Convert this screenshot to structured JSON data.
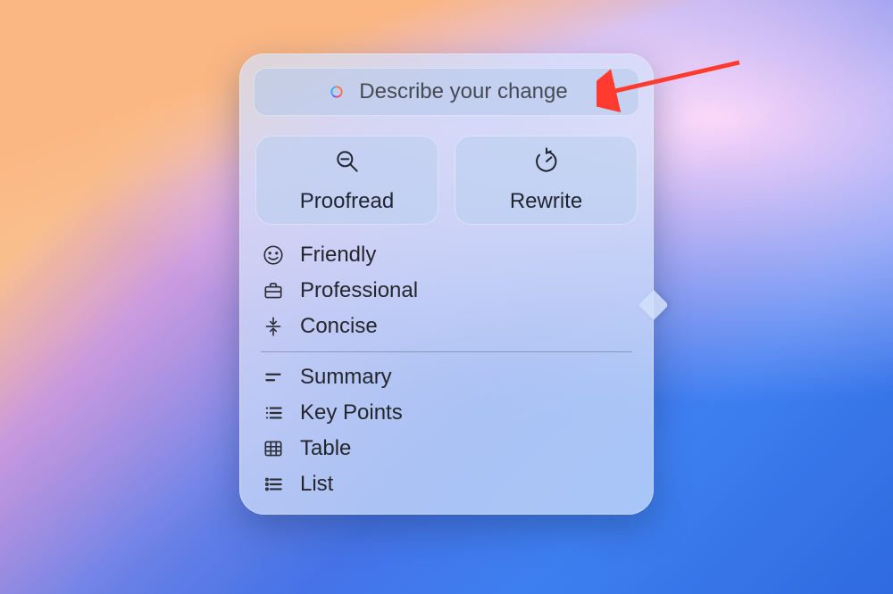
{
  "prompt": {
    "placeholder": "Describe your change",
    "icon": "apple-intelligence-logo"
  },
  "actions": [
    {
      "id": "proofread",
      "label": "Proofread",
      "icon": "search-check-icon"
    },
    {
      "id": "rewrite",
      "label": "Rewrite",
      "icon": "refresh-arrow-icon"
    }
  ],
  "tone_options": [
    {
      "id": "friendly",
      "label": "Friendly",
      "icon": "smile-icon"
    },
    {
      "id": "professional",
      "label": "Professional",
      "icon": "briefcase-icon"
    },
    {
      "id": "concise",
      "label": "Concise",
      "icon": "collapse-vertical-icon"
    }
  ],
  "format_options": [
    {
      "id": "summary",
      "label": "Summary",
      "icon": "lines-short-icon"
    },
    {
      "id": "key-points",
      "label": "Key Points",
      "icon": "bullet-list-icon"
    },
    {
      "id": "table",
      "label": "Table",
      "icon": "table-grid-icon"
    },
    {
      "id": "list",
      "label": "List",
      "icon": "numbered-list-icon"
    }
  ],
  "annotation": {
    "arrow_color": "#ff3b2f"
  }
}
